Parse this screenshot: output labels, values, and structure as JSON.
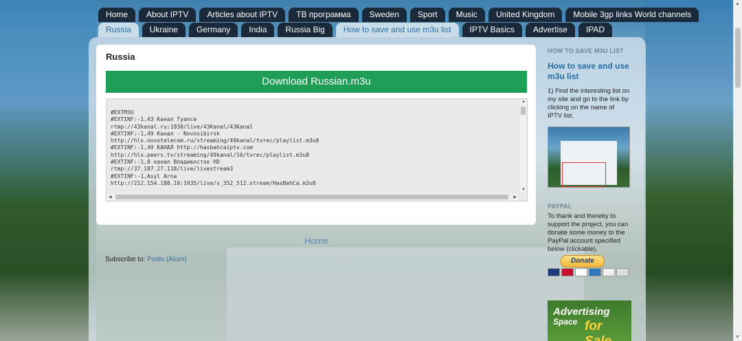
{
  "nav": {
    "row1": [
      "Home",
      "About IPTV",
      "Articles about IPTV",
      "ТВ программа",
      "Sweden",
      "Sport",
      "Music",
      "United Kingdom",
      "Mobile 3gp links World channels"
    ],
    "row2": [
      "Russia",
      "Ukraine",
      "Germany",
      "India",
      "Russia Big",
      "How to save and use m3u list",
      "IPTV Basics",
      "Advertise",
      "IPAD"
    ]
  },
  "post": {
    "title": "Russia",
    "download_label": "Download Russian.m3u",
    "code": "#EXTM3U\n#EXTINF:-1,43 Канал Туапсе\nrtmp://43kanal.ru:1938/live/43Kanal/43Kanal\n#EXTINF:-1,49 Канал - Novosibirsk\nhttp://hls.novotelecom.ru/streaming/49kanal/tvrec/playlist.m3u8\n#EXTINF:-1,49 КАНАЛ http://hasbahcaiptv.com\nhttp://hls.peers.tv/streaming/49kanal/16/tvrec/playlist.m3u8\n#EXTINF:-1,8 канал Владивосток HD\nrtmp://37.187.27.118/live/livestream3\n#EXTINF:-1,Asyl Arna\nhttp://212.154.188.10:1935/live/v_352_512.stream/HasBahCa.m3u8"
  },
  "footer": {
    "home_label": "Home",
    "subscribe_prefix": "Subscribe to: ",
    "subscribe_link": "Posts (Atom)"
  },
  "sidebar": {
    "section1_heading": "HOW TO SAVE M3U LIST",
    "section1_link": "How to save and use m3u list",
    "section1_text": "1) Find the interesting list on my site and go to the link by clicking on the name of IPTV list.",
    "section2_heading": "PAYPAL",
    "section2_text": "To thank and thereby to support the project, you can donate some money to the PayPal account specified below (clickable).",
    "donate_label": "Donate",
    "ad_line1": "Advertising",
    "ad_line2": "Space",
    "ad_line3": "for Sale"
  },
  "colors": {
    "download_button": "#1e9e57",
    "tab_dark": "#1a2a3a",
    "tab_active": "#c9dde9",
    "link": "#2a6ca4"
  }
}
